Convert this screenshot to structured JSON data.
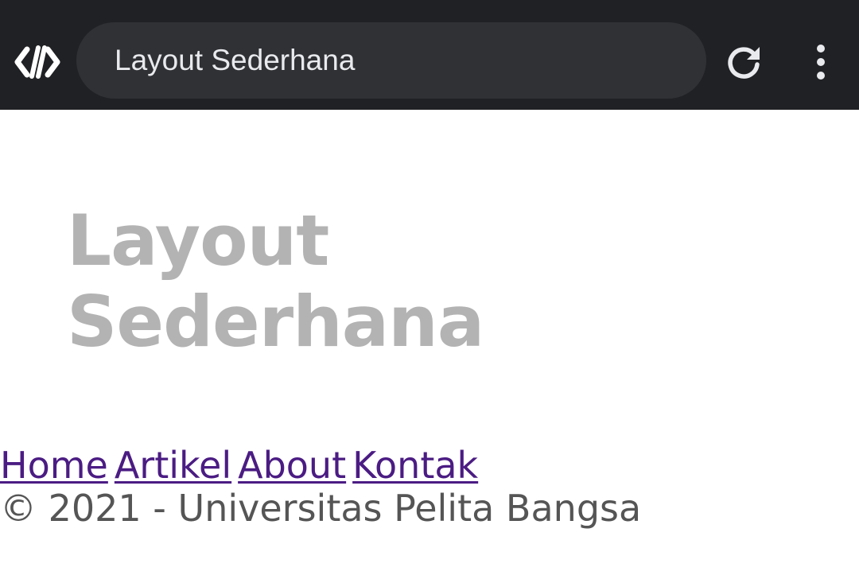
{
  "browser": {
    "address_text": "Layout Sederhana",
    "site_icon": "code-brackets-icon",
    "reload_icon": "reload-icon",
    "menu_icon": "more-vert-icon",
    "bar_color": "#202124",
    "box_color": "#303134"
  },
  "page": {
    "title_line1": "Layout",
    "title_line2": "Sederhana",
    "title_color": "#b3b3b3",
    "nav": {
      "home": "Home",
      "artikel": "Artikel",
      "about": "About",
      "kontak": "Kontak",
      "link_color": "#4b1c83"
    },
    "footer": "© 2021 - Universitas Pelita Bangsa"
  }
}
